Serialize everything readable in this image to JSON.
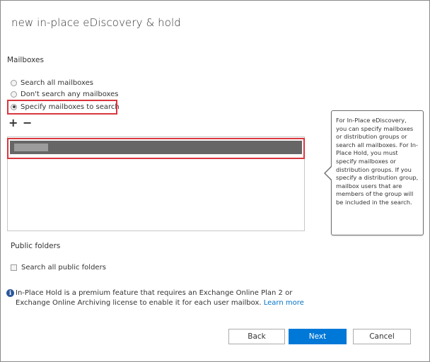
{
  "dialog": {
    "title": "new in-place eDiscovery & hold"
  },
  "mailboxes": {
    "section_label": "Mailboxes",
    "options": [
      {
        "label": "Search all mailboxes",
        "checked": false
      },
      {
        "label": "Don't search any mailboxes",
        "checked": false
      },
      {
        "label": "Specify mailboxes to search",
        "checked": true
      }
    ],
    "toolbar": {
      "add_icon": "plus-icon",
      "remove_icon": "minus-icon"
    },
    "list": {
      "selected_row_text": ""
    }
  },
  "tooltip": {
    "text": "For In-Place eDiscovery, you can specify mailboxes or distribution groups or search all mailboxes. For In-Place Hold, you must specify mailboxes or distribution groups. If you specify a distribution group, mailbox users that are members of the group will be included in the search."
  },
  "public_folders": {
    "section_label": "Public folders",
    "checkbox_label": "Search all public folders",
    "checked": false
  },
  "info": {
    "icon": "info-icon",
    "text": "In-Place Hold is a premium feature that requires an Exchange Online Plan 2 or Exchange Online Archiving license to enable it for each user mailbox. ",
    "link_text": "Learn more"
  },
  "buttons": {
    "back": "Back",
    "next": "Next",
    "cancel": "Cancel"
  },
  "colors": {
    "accent": "#0078d7",
    "highlight": "#d9363e",
    "selected_row": "#666666"
  }
}
